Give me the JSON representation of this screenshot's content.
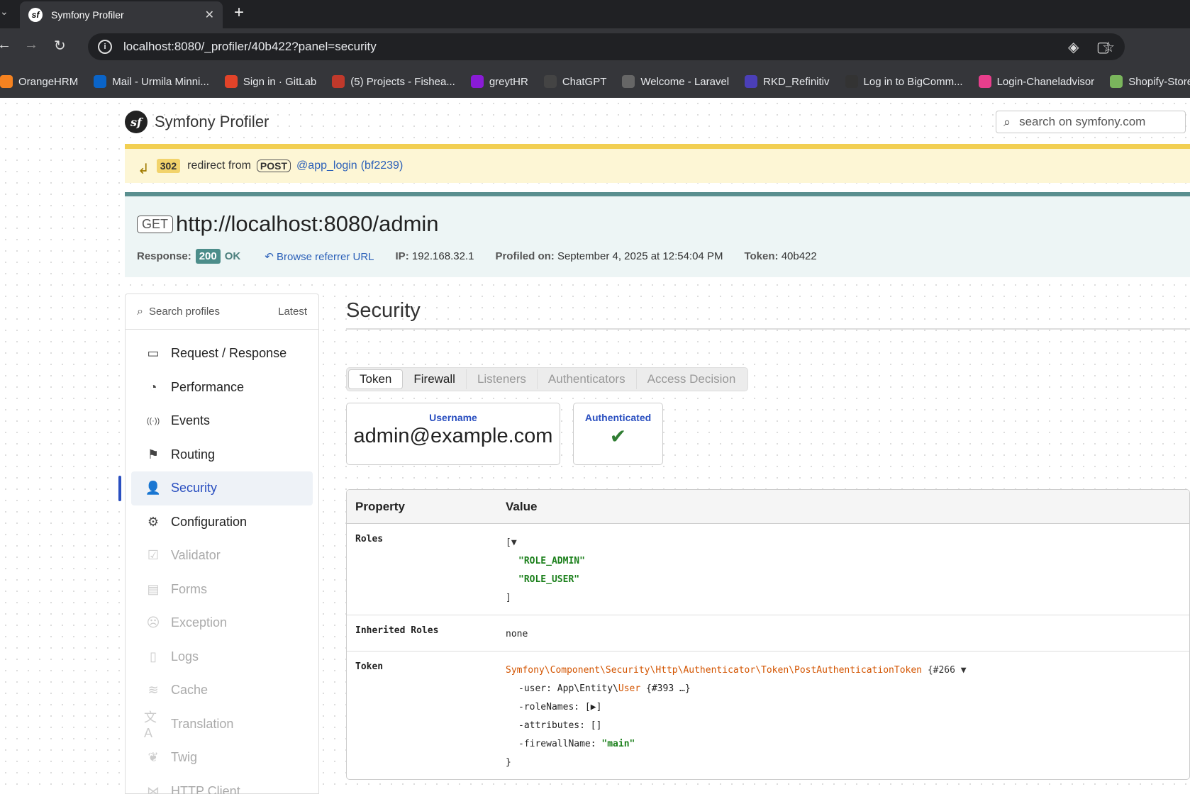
{
  "browser": {
    "tab_title": "Symfony Profiler",
    "url": "localhost:8080/_profiler/40b422?panel=security",
    "bookmarks": [
      {
        "label": "OrangeHRM",
        "color": "#f58220"
      },
      {
        "label": "Mail - Urmila Minni...",
        "color": "#0a64c8"
      },
      {
        "label": "Sign in · GitLab",
        "color": "#e24329"
      },
      {
        "label": "(5) Projects - Fishea...",
        "color": "#c0392b"
      },
      {
        "label": "greytHR",
        "color": "#8a1bd6"
      },
      {
        "label": "ChatGPT",
        "color": "#444444"
      },
      {
        "label": "Welcome - Laravel",
        "color": "#666666"
      },
      {
        "label": "RKD_Refinitiv",
        "color": "#4b3fb8"
      },
      {
        "label": "Log in to BigComm...",
        "color": "#333333"
      },
      {
        "label": "Login-Chaneladvisor",
        "color": "#e83e8c"
      },
      {
        "label": "Shopify-Stores",
        "color": "#7ab55c"
      }
    ]
  },
  "header": {
    "title": "Symfony Profiler",
    "search_placeholder": "search on symfony.com"
  },
  "redirect": {
    "status": "302",
    "text": "redirect from",
    "method": "POST",
    "route": "@app_login",
    "token_link": "(bf2239)"
  },
  "summary": {
    "method": "GET",
    "url": "http://localhost:8080/admin",
    "response_label": "Response:",
    "status": "200",
    "status_text": "OK",
    "referrer_link": "Browse referrer URL",
    "ip_label": "IP:",
    "ip": "192.168.32.1",
    "profiled_label": "Profiled on:",
    "profiled_on": "September 4, 2025 at 12:54:04 PM",
    "token_label": "Token:",
    "token": "40b422"
  },
  "sidebar": {
    "search_label": "Search profiles",
    "latest_label": "Latest",
    "items": [
      {
        "label": "Request / Response",
        "icon": "request-icon",
        "glyph": "▭",
        "state": "normal"
      },
      {
        "label": "Performance",
        "icon": "performance-icon",
        "glyph": "◔",
        "state": "normal"
      },
      {
        "label": "Events",
        "icon": "events-icon",
        "glyph": "((·))",
        "state": "normal"
      },
      {
        "label": "Routing",
        "icon": "routing-icon",
        "glyph": "⚑",
        "state": "normal"
      },
      {
        "label": "Security",
        "icon": "security-icon",
        "glyph": "👤",
        "state": "active"
      },
      {
        "label": "Configuration",
        "icon": "configuration-icon",
        "glyph": "⚙",
        "state": "normal"
      },
      {
        "label": "Validator",
        "icon": "validator-icon",
        "glyph": "☑",
        "state": "disabled"
      },
      {
        "label": "Forms",
        "icon": "forms-icon",
        "glyph": "▤",
        "state": "disabled"
      },
      {
        "label": "Exception",
        "icon": "exception-icon",
        "glyph": "☹",
        "state": "disabled"
      },
      {
        "label": "Logs",
        "icon": "logs-icon",
        "glyph": "▯",
        "state": "disabled"
      },
      {
        "label": "Cache",
        "icon": "cache-icon",
        "glyph": "≋",
        "state": "disabled"
      },
      {
        "label": "Translation",
        "icon": "translation-icon",
        "glyph": "文A",
        "state": "disabled"
      },
      {
        "label": "Twig",
        "icon": "twig-icon",
        "glyph": "❦",
        "state": "disabled"
      },
      {
        "label": "HTTP Client",
        "icon": "http-client-icon",
        "glyph": "⋈",
        "state": "disabled"
      }
    ]
  },
  "main": {
    "title": "Security",
    "tabs": [
      {
        "label": "Token",
        "state": "active"
      },
      {
        "label": "Firewall",
        "state": "enabled"
      },
      {
        "label": "Listeners",
        "state": "disabled"
      },
      {
        "label": "Authenticators",
        "state": "disabled"
      },
      {
        "label": "Access Decision",
        "state": "disabled"
      }
    ],
    "metrics": {
      "username_label": "Username",
      "username_value": "admin@example.com",
      "authenticated_label": "Authenticated",
      "authenticated_value": "✔"
    },
    "table": {
      "col_property": "Property",
      "col_value": "Value",
      "roles_label": "Roles",
      "roles_open": "[▼",
      "roles": [
        "\"ROLE_ADMIN\"",
        "\"ROLE_USER\""
      ],
      "roles_close": "]",
      "inherited_label": "Inherited Roles",
      "inherited_value": "none",
      "token_label": "Token",
      "token_class": "Symfony\\Component\\Security\\Http\\Authenticator\\Token\\PostAuthenticationToken",
      "token_ref": " {#266 ▼",
      "user_key": "-user: ",
      "user_ns": "App\\Entity\\",
      "user_class": "User",
      "user_ref": " {#393 …}",
      "rolenames_line": "-roleNames: [▶]",
      "attributes_line": "-attributes: []",
      "firewall_key": "-firewallName: ",
      "firewall_value": "\"main\"",
      "token_close": "}"
    }
  }
}
